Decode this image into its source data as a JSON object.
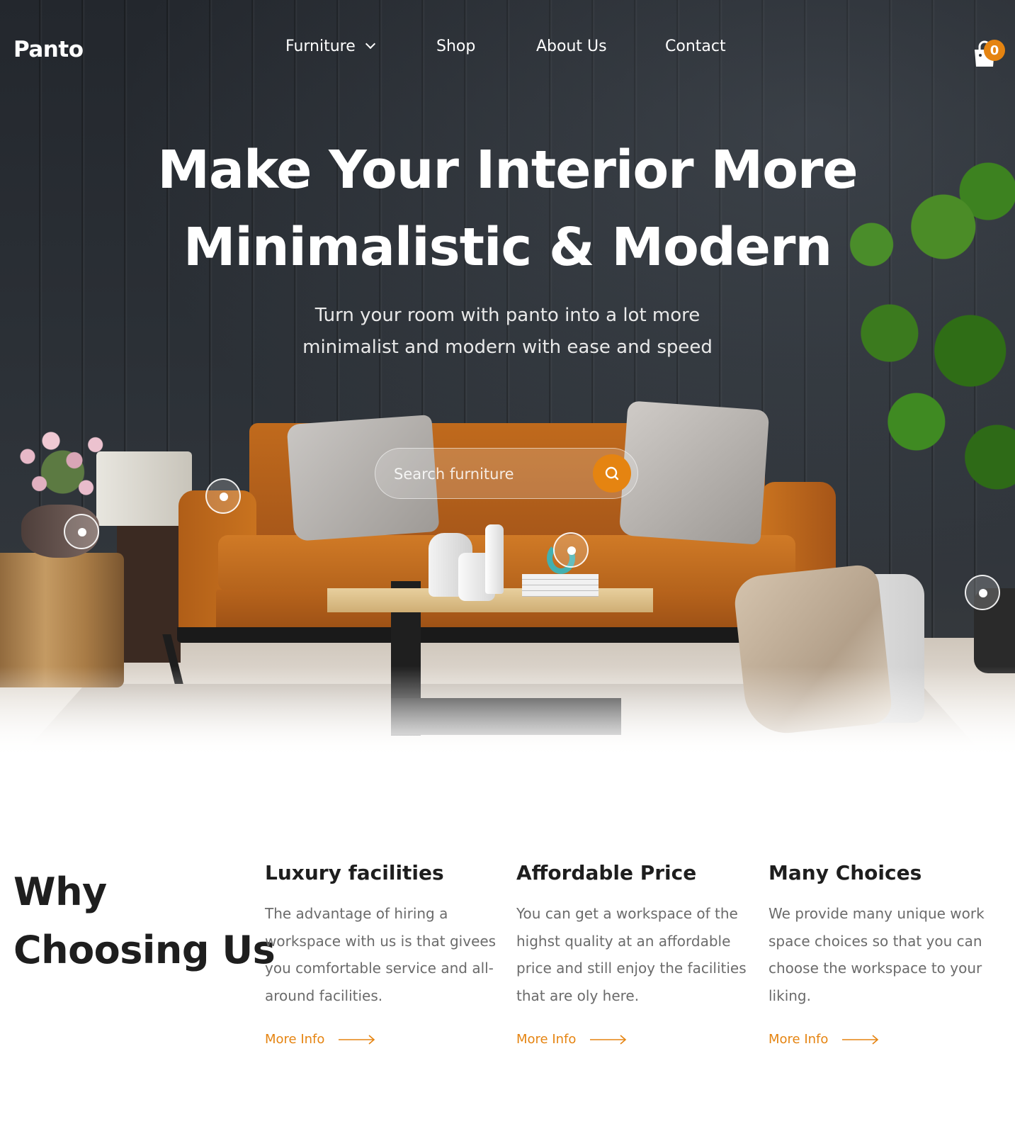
{
  "brand": {
    "logo": "Panto",
    "accent": "#e58411"
  },
  "nav": {
    "items": [
      {
        "label": "Furniture",
        "has_dropdown": true
      },
      {
        "label": "Shop"
      },
      {
        "label": "About Us"
      },
      {
        "label": "Contact"
      }
    ],
    "cart_count": "0",
    "cart_icon": "shopping-bag-icon"
  },
  "hero": {
    "title_line1": "Make Your Interior More",
    "title_line2": "Minimalistic & Modern",
    "subtitle_line1": "Turn your room with panto into a lot more",
    "subtitle_line2": "minimalist and modern with ease and speed",
    "search": {
      "placeholder": "Search furniture",
      "value": "",
      "icon": "search-icon"
    }
  },
  "why": {
    "title_line1": "Why",
    "title_line2": "Choosing Us",
    "features": [
      {
        "title": "Luxury facilities",
        "text": "The advantage of hiring a workspace with us is that givees you comfortable service and all-around facilities.",
        "link": "More Info"
      },
      {
        "title": "Affordable Price",
        "text": "You can get a workspace of the highst quality at an affordable price and still enjoy the facilities that are oly here.",
        "link": "More Info"
      },
      {
        "title": "Many Choices",
        "text": "We provide many unique work space choices so that you can choose the workspace to your liking.",
        "link": "More Info"
      }
    ]
  }
}
